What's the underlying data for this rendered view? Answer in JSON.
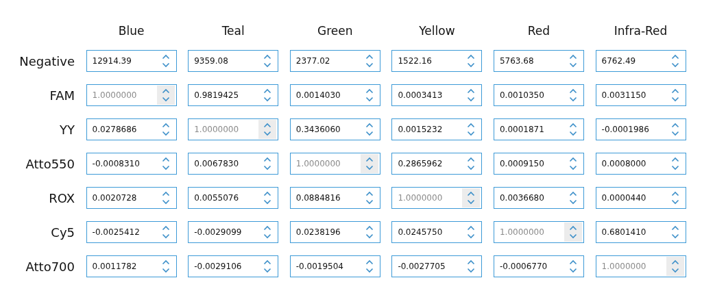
{
  "columns": [
    "Blue",
    "Teal",
    "Green",
    "Yellow",
    "Red",
    "Infra-Red"
  ],
  "rows": [
    {
      "label": "Negative",
      "cells": [
        {
          "value": "12914.39",
          "disabled": false
        },
        {
          "value": "9359.08",
          "disabled": false
        },
        {
          "value": "2377.02",
          "disabled": false
        },
        {
          "value": "1522.16",
          "disabled": false
        },
        {
          "value": "5763.68",
          "disabled": false
        },
        {
          "value": "6762.49",
          "disabled": false
        }
      ]
    },
    {
      "label": "FAM",
      "cells": [
        {
          "value": "1.0000000",
          "disabled": true
        },
        {
          "value": "0.9819425",
          "disabled": false
        },
        {
          "value": "0.0014030",
          "disabled": false
        },
        {
          "value": "0.0003413",
          "disabled": false
        },
        {
          "value": "0.0010350",
          "disabled": false
        },
        {
          "value": "0.0031150",
          "disabled": false
        }
      ]
    },
    {
      "label": "YY",
      "cells": [
        {
          "value": "0.0278686",
          "disabled": false
        },
        {
          "value": "1.0000000",
          "disabled": true
        },
        {
          "value": "0.3436060",
          "disabled": false
        },
        {
          "value": "0.0015232",
          "disabled": false
        },
        {
          "value": "0.0001871",
          "disabled": false
        },
        {
          "value": "-0.0001986",
          "disabled": false
        }
      ]
    },
    {
      "label": "Atto550",
      "cells": [
        {
          "value": "-0.0008310",
          "disabled": false
        },
        {
          "value": "0.0067830",
          "disabled": false
        },
        {
          "value": "1.0000000",
          "disabled": true
        },
        {
          "value": "0.2865962",
          "disabled": false
        },
        {
          "value": "0.0009150",
          "disabled": false
        },
        {
          "value": "0.0008000",
          "disabled": false
        }
      ]
    },
    {
      "label": "ROX",
      "cells": [
        {
          "value": "0.0020728",
          "disabled": false
        },
        {
          "value": "0.0055076",
          "disabled": false
        },
        {
          "value": "0.0884816",
          "disabled": false
        },
        {
          "value": "1.0000000",
          "disabled": true
        },
        {
          "value": "0.0036680",
          "disabled": false
        },
        {
          "value": "0.0000440",
          "disabled": false
        }
      ]
    },
    {
      "label": "Cy5",
      "cells": [
        {
          "value": "-0.0025412",
          "disabled": false
        },
        {
          "value": "-0.0029099",
          "disabled": false
        },
        {
          "value": "0.0238196",
          "disabled": false
        },
        {
          "value": "0.0245750",
          "disabled": false
        },
        {
          "value": "1.0000000",
          "disabled": true
        },
        {
          "value": "0.6801410",
          "disabled": false
        }
      ]
    },
    {
      "label": "Atto700",
      "cells": [
        {
          "value": "0.0011782",
          "disabled": false
        },
        {
          "value": "-0.0029106",
          "disabled": false
        },
        {
          "value": "-0.0019504",
          "disabled": false
        },
        {
          "value": "-0.0027705",
          "disabled": false
        },
        {
          "value": "-0.0006770",
          "disabled": false
        },
        {
          "value": "1.0000000",
          "disabled": true
        }
      ]
    }
  ]
}
